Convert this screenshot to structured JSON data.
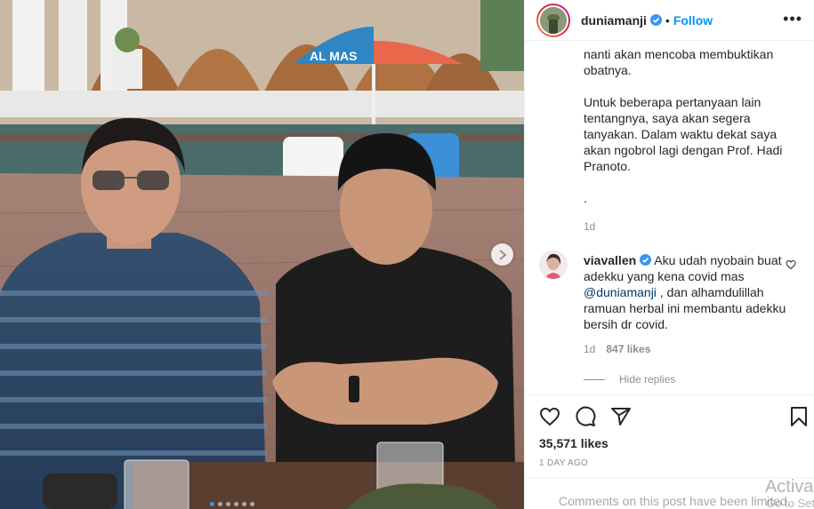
{
  "post": {
    "username": "duniamanji",
    "separator": "•",
    "follow_label": "Follow",
    "more_label": "•••",
    "caption": {
      "line1": "nanti akan mencoba membuktikan obatnya.",
      "line2": "Untuk beberapa pertanyaan lain tentangnya, saya akan segera tanyakan. Dalam waktu dekat saya akan ngobrol lagi dengan Prof. Hadi Pranoto.",
      "line3": ".",
      "time": "1d"
    },
    "comment": {
      "username": "viavallen",
      "text_before": " Aku udah nyobain buat adekku yang kena covid mas ",
      "mention": "@duniamanji",
      "text_after": " , dan alhamdulillah ramuan herbal ini membantu adekku bersih dr covid.",
      "time": "1d",
      "likes": "847 likes",
      "hide_replies": "Hide replies"
    },
    "likes": "35,571 likes",
    "posted_ago": "1 DAY AGO",
    "comments_limited": "Comments on this post have been limited.",
    "watermark_line1": "Activat",
    "watermark_line2": "Go to Set",
    "photo_umbrella_text": "AL MAS",
    "icons": [
      "heart-icon",
      "comment-icon",
      "share-icon",
      "bookmark-icon",
      "verified-badge-icon",
      "next-arrow-icon"
    ],
    "colors": {
      "link": "#0095f6",
      "verified": "#3897f0",
      "muted": "#8e8e8e"
    }
  }
}
